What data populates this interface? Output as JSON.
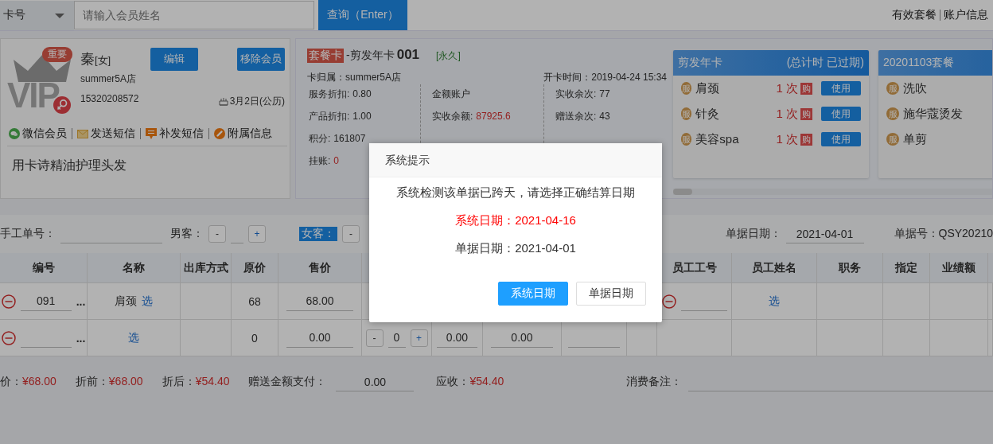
{
  "search_bar": {
    "type_select": "卡号",
    "placeholder": "请输入会员姓名",
    "search_button": "查询（Enter）"
  },
  "top_links": [
    "有效套餐",
    "账户信息"
  ],
  "member": {
    "badge": "重要",
    "logo_text": "VIP",
    "name": "秦",
    "gender": "[女]",
    "buttons": [
      "编辑",
      "移除会员"
    ],
    "store": "summer5A店",
    "phone": "15320208572",
    "birthday": "3月2日(公历)",
    "actions": [
      {
        "kind": "wechat",
        "label": "微信会员"
      },
      {
        "kind": "mail",
        "label": "发送短信"
      },
      {
        "kind": "message",
        "label": "补发短信"
      },
      {
        "kind": "link",
        "label": "附属信息"
      }
    ],
    "note": "用卡诗精油护理头发"
  },
  "card": {
    "type_tag": "套餐卡",
    "name": "-剪发年卡",
    "number": "001",
    "validity": "[永久]",
    "owner_label": "卡归属：",
    "owner": "summer5A店",
    "opened_label": "开卡时间：",
    "opened": "2019-04-24 15:34",
    "columns": [
      [
        {
          "label": "服务折扣:",
          "value": "0.80",
          "alert": false
        },
        {
          "label": "产品折扣:",
          "value": "1.00",
          "alert": false
        },
        {
          "label": "积分:",
          "value": "161807",
          "alert": false
        },
        {
          "label": "挂账:",
          "value": "0",
          "alert": true
        }
      ],
      [
        {
          "label": "金额账户"
        },
        {
          "label": "实收余额:",
          "value": "87925.6",
          "alert": true
        }
      ],
      [
        {
          "label": "实收余次:",
          "value": "77",
          "alert": false
        },
        {
          "label": "赠送余次:",
          "value": "43",
          "alert": false
        }
      ]
    ]
  },
  "packages": [
    {
      "title": "剪发年卡",
      "status": "(总计时 已过期)",
      "items": [
        {
          "icon_text": "服",
          "name": "肩颈",
          "count": "1 次",
          "buy": "购",
          "use": "使用"
        },
        {
          "icon_text": "服",
          "name": "针灸",
          "count": "1 次",
          "buy": "购",
          "use": "使用"
        },
        {
          "icon_text": "服",
          "name": "美容spa",
          "count": "1 次",
          "buy": "购",
          "use": "使用"
        }
      ]
    },
    {
      "title": "20201103套餐",
      "items": [
        {
          "icon_text": "服",
          "name": "洗吹"
        },
        {
          "icon_text": "服",
          "name": "施华蔻烫发"
        },
        {
          "icon_text": "服",
          "name": "单剪"
        }
      ]
    }
  ],
  "form": {
    "manual_no_label": "手工单号：",
    "male_label": "男客：",
    "male_stepper": {
      "minus": "-",
      "plus": "+"
    },
    "female_label": "女客：",
    "female_stepper": {
      "minus": "-"
    },
    "doc_date_label": "单据日期：",
    "doc_date": "2021-04-01",
    "doc_no_label": "单据号：",
    "doc_no": "QSY20210"
  },
  "table": {
    "columns_left": [
      "编号",
      "名称",
      "出库方式",
      "原价",
      "售价"
    ],
    "columns_right": [
      "员工工号",
      "员工姓名",
      "职务",
      "指定",
      "业绩额"
    ],
    "rows": [
      [
        {
          "kind": "code",
          "value": "091",
          "more": "..."
        },
        {
          "kind": "name",
          "text": "肩颈",
          "pick": "选"
        },
        {
          "kind": "blank"
        },
        {
          "kind": "text",
          "value": "68"
        },
        {
          "kind": "input",
          "value": "68.00"
        },
        {
          "kind": "blank"
        },
        {
          "kind": "blank"
        },
        {
          "kind": "blank"
        },
        {
          "kind": "blank"
        },
        {
          "kind": "blank"
        },
        {
          "kind": "staff"
        },
        {
          "kind": "name",
          "pick": "选"
        },
        {
          "kind": "blank"
        },
        {
          "kind": "blank"
        },
        {
          "kind": "blank"
        },
        {
          "kind": "blank"
        }
      ],
      [
        {
          "kind": "code",
          "more": "..."
        },
        {
          "kind": "name",
          "pick": "选"
        },
        {
          "kind": "blank"
        },
        {
          "kind": "text",
          "value": "0"
        },
        {
          "kind": "input",
          "value": "0.00"
        },
        {
          "kind": "stepper",
          "minus": "-",
          "value": "0",
          "plus": "+"
        },
        {
          "kind": "input",
          "value": "0.00"
        },
        {
          "kind": "input",
          "value": "0.00"
        },
        {
          "kind": "input"
        },
        {
          "kind": "blank"
        },
        {
          "kind": "blank"
        },
        {
          "kind": "blank"
        },
        {
          "kind": "blank"
        },
        {
          "kind": "blank"
        },
        {
          "kind": "blank"
        },
        {
          "kind": "blank"
        }
      ]
    ]
  },
  "totals": [
    {
      "label": "价：",
      "value": "¥68.00"
    },
    {
      "label": "折前：",
      "value": "¥68.00"
    },
    {
      "label": "折后：",
      "value": "¥54.40"
    }
  ],
  "gift_pay": {
    "label": "赠送金额支付：",
    "value": "0.00"
  },
  "receivable": {
    "label": "应收：",
    "value": "¥54.40"
  },
  "remark": {
    "label": "消费备注："
  },
  "dialog": {
    "title": "系统提示",
    "message": "系统检测该单据已跨天，请选择正确结算日期",
    "lines": [
      {
        "text": "系统日期：2021-04-16",
        "alert": true
      },
      {
        "text": "单据日期：2021-04-01",
        "alert": false
      }
    ],
    "buttons": [
      {
        "label": "系统日期",
        "primary": true
      },
      {
        "label": "单据日期",
        "primary": false
      }
    ]
  }
}
